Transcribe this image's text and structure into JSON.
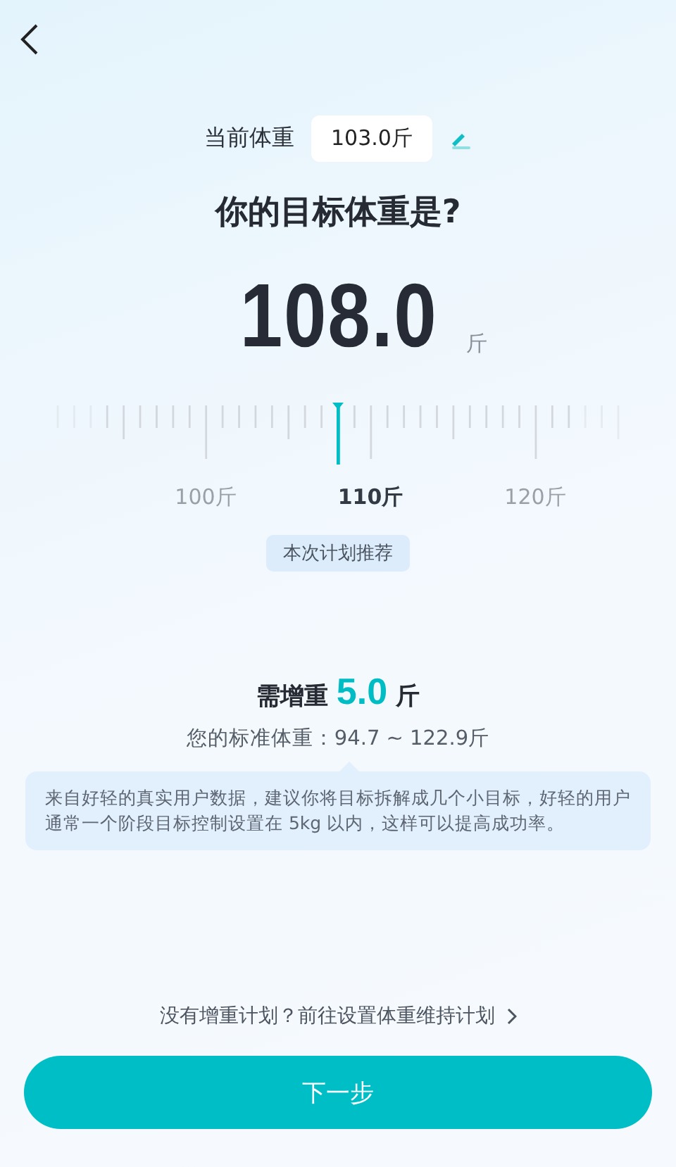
{
  "current_weight": {
    "label": "当前体重",
    "value": "103.0斤"
  },
  "title": "你的目标体重是?",
  "target": {
    "value": "108.0",
    "unit": "斤"
  },
  "ruler": {
    "labels": [
      {
        "text": "100斤",
        "selected": false
      },
      {
        "text": "110斤",
        "selected": true
      },
      {
        "text": "120斤",
        "selected": false
      }
    ]
  },
  "recommend_tag": "本次计划推荐",
  "gain": {
    "label": "需增重",
    "value": "5.0",
    "unit": "斤"
  },
  "standard_weight": "您的标准体重：94.7 ~ 122.9斤",
  "tip": "来自好轻的真实用户数据，建议你将目标拆解成几个小目标，好轻的用户通常一个阶段目标控制设置在 5kg 以内，这样可以提高成功率。",
  "maintain_link": "没有增重计划？前往设置体重维持计划",
  "next_button": "下一步"
}
